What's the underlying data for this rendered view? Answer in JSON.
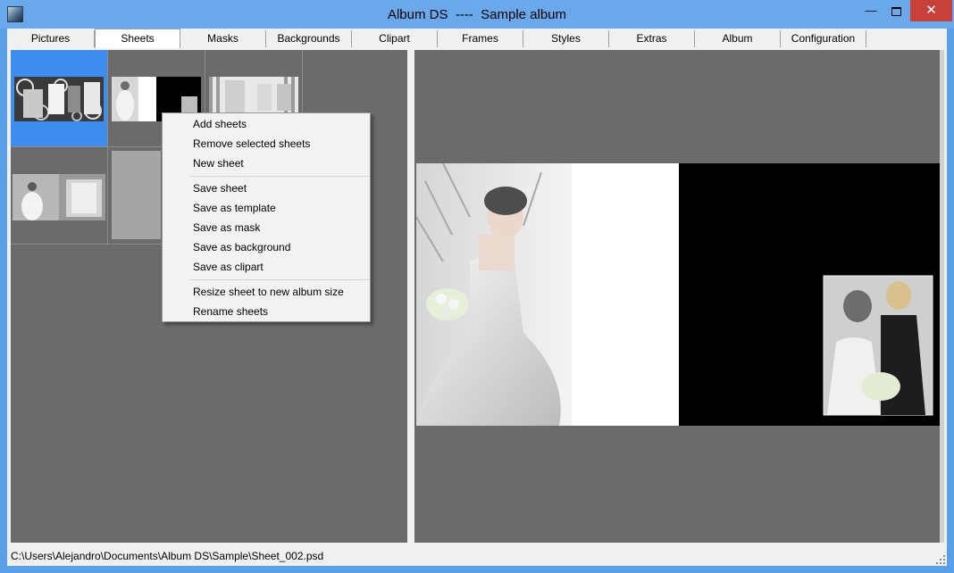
{
  "window": {
    "title": "Album DS  ----  Sample album",
    "minimize_symbol": "—",
    "close_symbol": "✕"
  },
  "tabs": [
    {
      "label": "Pictures",
      "active": false
    },
    {
      "label": "Sheets",
      "active": true
    },
    {
      "label": "Masks",
      "active": false
    },
    {
      "label": "Backgrounds",
      "active": false
    },
    {
      "label": "Clipart",
      "active": false
    },
    {
      "label": "Frames",
      "active": false
    },
    {
      "label": "Styles",
      "active": false
    },
    {
      "label": "Extras",
      "active": false
    },
    {
      "label": "Album",
      "active": false
    },
    {
      "label": "Configuration",
      "active": false
    }
  ],
  "sheets": {
    "thumbnails": [
      {
        "name": "sheet-001",
        "selected": true
      },
      {
        "name": "sheet-002",
        "selected": false
      },
      {
        "name": "sheet-003",
        "selected": false
      },
      {
        "name": "sheet-004",
        "selected": false
      },
      {
        "name": "sheet-005",
        "selected": false
      }
    ]
  },
  "context_menu": {
    "groups": [
      [
        "Add sheets",
        "Remove selected sheets",
        "New sheet"
      ],
      [
        "Save sheet",
        "Save as template",
        "Save as mask",
        "Save as background",
        "Save as clipart"
      ],
      [
        "Resize sheet to new album size",
        "Rename sheets"
      ]
    ]
  },
  "status": {
    "path": "C:\\Users\\Alejandro\\Documents\\Album DS\\Sample\\Sheet_002.psd"
  },
  "colors": {
    "title_bar": "#6aa8ec",
    "close_button": "#c7403a",
    "panel_bg": "#6b6b6b",
    "selection": "#3e8ef0",
    "menu_bg": "#f2f2f2"
  }
}
